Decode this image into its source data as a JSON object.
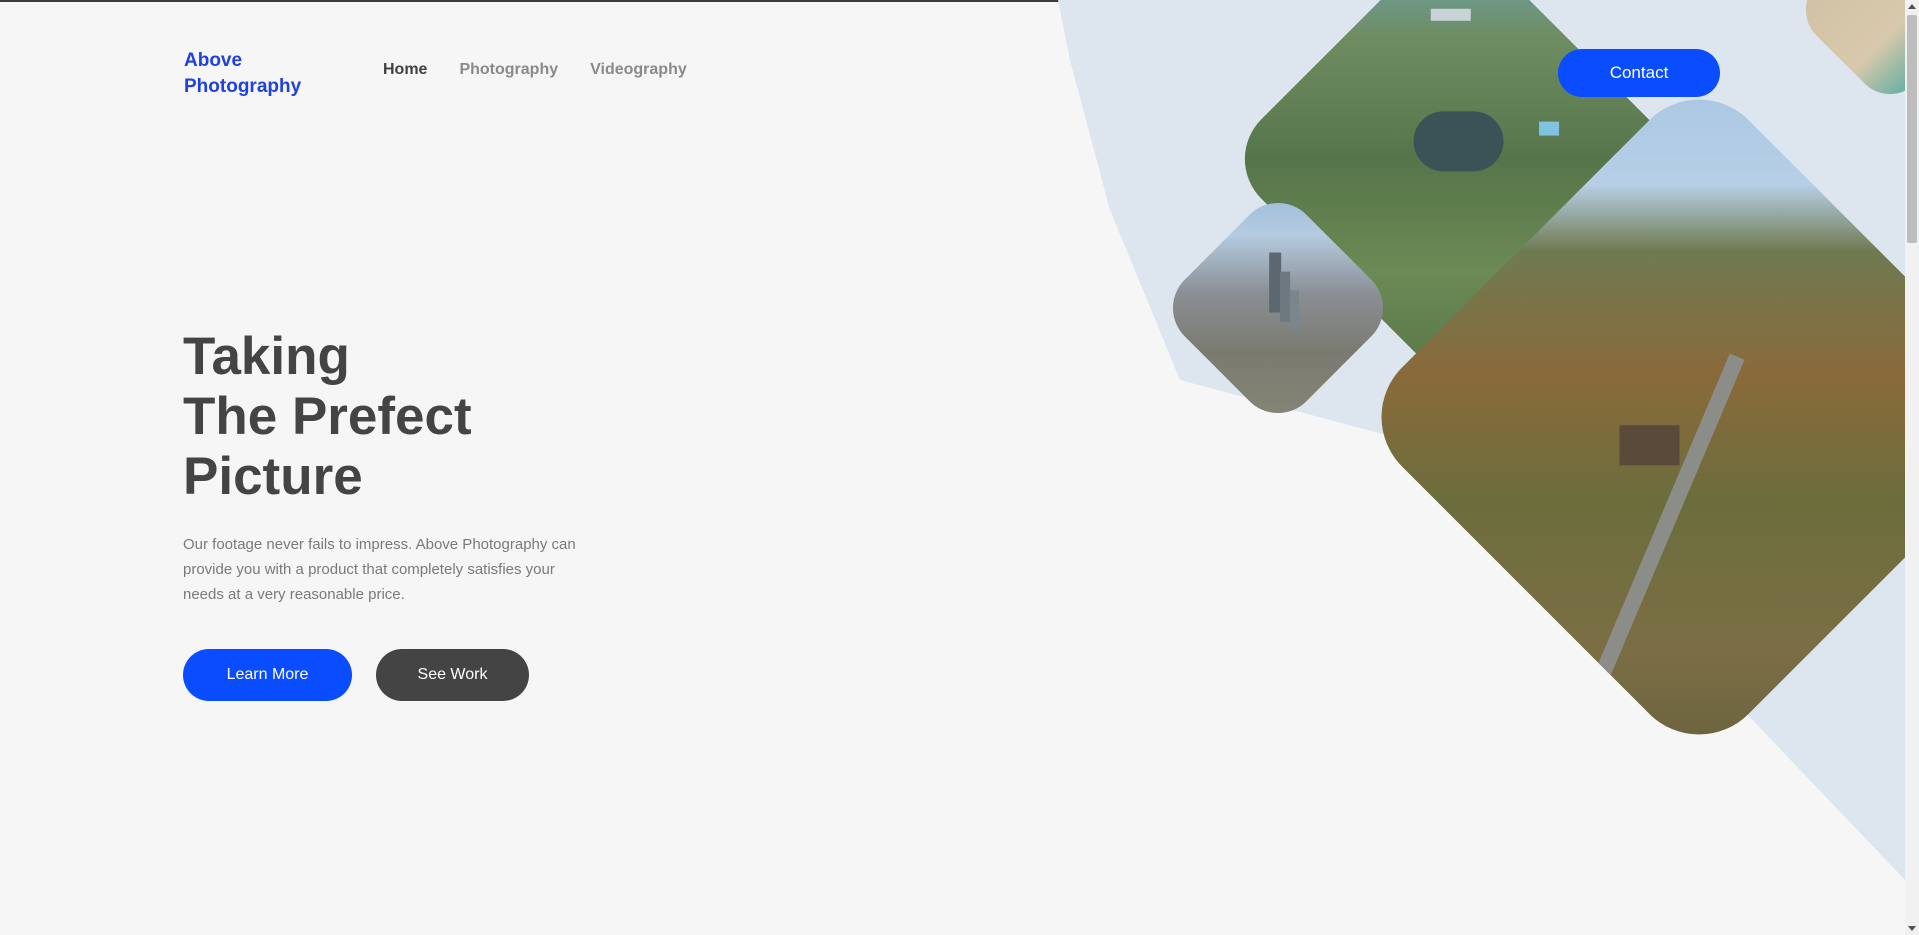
{
  "brand": {
    "logo": "Above Photography"
  },
  "nav": {
    "items": [
      {
        "label": "Home",
        "active": true
      },
      {
        "label": "Photography",
        "active": false
      },
      {
        "label": "Videography",
        "active": false
      }
    ],
    "contact_label": "Contact"
  },
  "hero": {
    "title_lines": [
      "Taking",
      "The Prefect",
      "Picture"
    ],
    "description": "Our footage never fails to impress. Above Photography can provide you with a product that completely satisfies your needs at a very reasonable price.",
    "learn_more_label": "Learn More",
    "see_work_label": "See Work"
  },
  "images": [
    {
      "name": "aerial-resort-photo"
    },
    {
      "name": "city-skyline-photo"
    },
    {
      "name": "countryside-road-photo"
    },
    {
      "name": "beach-photo"
    }
  ],
  "colors": {
    "accent": "#0a4cff",
    "logo": "#1f41e0",
    "dark_button": "#444444",
    "background": "#f6f6f6",
    "band": "#dde6ee"
  }
}
